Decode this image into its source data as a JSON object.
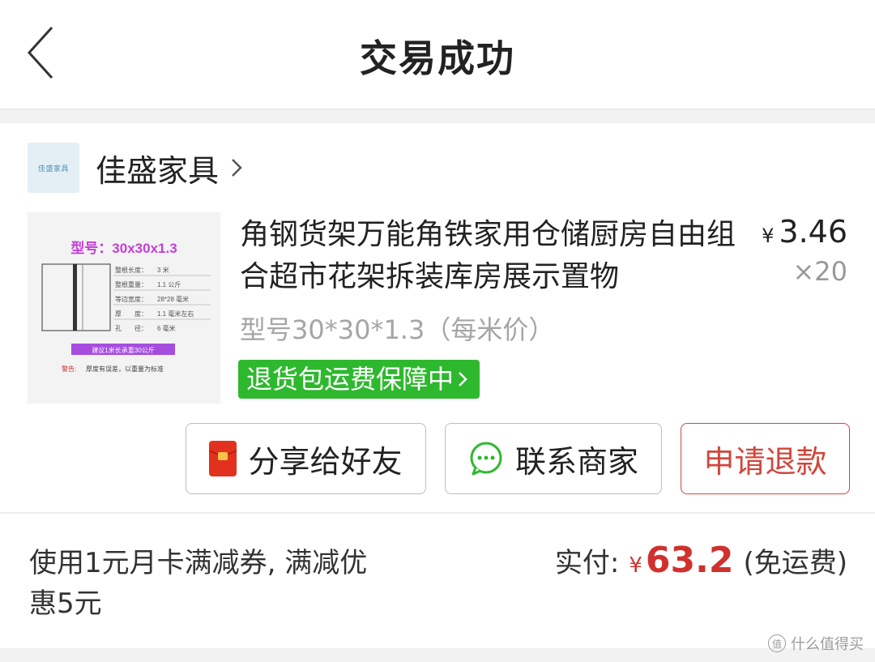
{
  "header": {
    "title": "交易成功"
  },
  "shop": {
    "name": "佳盛家具",
    "logo_text": "佳盛家具"
  },
  "product": {
    "title": "角钢货架万能角铁家用仓储厨房自由组合超市花架拆装库房展示置物",
    "price_symbol": "¥",
    "price": "3.46",
    "quantity": "×20",
    "variant": "型号30*30*1.3（每米价）",
    "badge": "退货包运费保障中",
    "thumbnail": {
      "model": "型号：30x30x1.3",
      "specs": [
        {
          "k": "整根长度：",
          "v": "3 米"
        },
        {
          "k": "整根重量：",
          "v": "1.1 公斤"
        },
        {
          "k": "等边宽度：",
          "v": "28*28 毫米"
        },
        {
          "k": "厚　　度：",
          "v": "1.1 毫米左右"
        },
        {
          "k": "孔　　径：",
          "v": "6 毫米"
        }
      ],
      "load_tip": "建议1米长承重30公斤",
      "warn_label": "警告:",
      "warn_text": "厚度有误差，以重量为标准"
    }
  },
  "actions": {
    "share": "分享给好友",
    "contact": "联系商家",
    "refund": "申请退款"
  },
  "footer": {
    "coupon": "使用1元月卡满减券, 满减优惠5元",
    "paid_label": "实付:",
    "paid_symbol": "¥",
    "paid_amount": "63.2",
    "paid_note": "(免运费)"
  },
  "watermark": {
    "icon": "值",
    "text": "什么值得买"
  },
  "colors": {
    "accent_red": "#d0312d",
    "badge_green": "#2eb82e",
    "refund_border": "#d0463c"
  }
}
